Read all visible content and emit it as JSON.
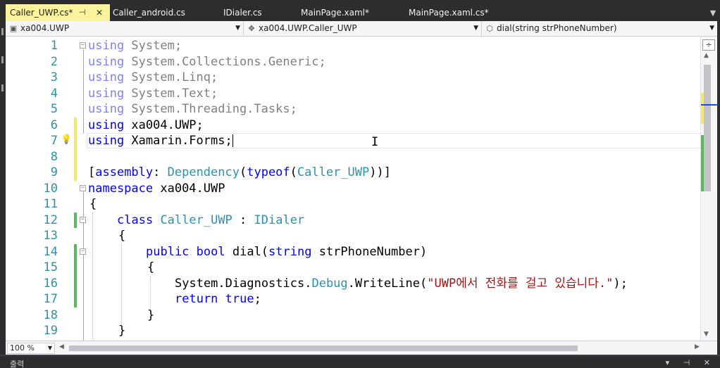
{
  "tabs": [
    {
      "label": "Caller_UWP.cs*",
      "active": true,
      "pin": "⊣",
      "close": "✕"
    },
    {
      "label": "Caller_android.cs",
      "active": false
    },
    {
      "label": "IDialer.cs",
      "active": false
    },
    {
      "label": "MainPage.xaml*",
      "active": false
    },
    {
      "label": "MainPage.xaml.cs*",
      "active": false
    }
  ],
  "tab_dropdown": "▼",
  "nav": {
    "project": "xa004.UWP",
    "type": "xa004.UWP.Caller_UWP",
    "member": "dial(string strPhoneNumber)",
    "project_icon": "csharp-project-icon",
    "type_icon": "class-icon",
    "member_icon": "method-icon"
  },
  "editor": {
    "line_numbers": [
      "1",
      "2",
      "3",
      "4",
      "5",
      "6",
      "7",
      "8",
      "9",
      "10",
      "11",
      "12",
      "13",
      "14",
      "15",
      "16",
      "17",
      "18",
      "19"
    ],
    "lines": {
      "l1a": "using",
      "l1b": " System;",
      "l2a": "using",
      "l2b": " System.Collections.Generic;",
      "l3a": "using",
      "l3b": " System.Linq;",
      "l4a": "using",
      "l4b": " System.Text;",
      "l5a": "using",
      "l5b": " System.Threading.Tasks;",
      "l6a": "using",
      "l6b": " xa004.UWP;",
      "l7a": "using",
      "l7b": " Xamarin.Forms;",
      "l9a": "[",
      "l9b": "assembly",
      "l9c": ": ",
      "l9d": "Dependency",
      "l9e": "(",
      "l9f": "typeof",
      "l9g": "(",
      "l9h": "Caller_UWP",
      "l9i": "))]",
      "l10a": "namespace",
      "l10b": " xa004.UWP",
      "l11": "{",
      "l12a": "class",
      "l12b": " ",
      "l12c": "Caller_UWP",
      "l12d": " : ",
      "l12e": "IDialer",
      "l13": "{",
      "l14a": "public",
      "l14b": " ",
      "l14c": "bool",
      "l14d": " dial(",
      "l14e": "string",
      "l14f": " strPhoneNumber)",
      "l15": "{",
      "l16a": "System.Diagnostics.",
      "l16b": "Debug",
      "l16c": ".WriteLine(",
      "l16d": "\"UWP에서 전화를 걸고 있습니다.\"",
      "l16e": ");",
      "l17a": "return",
      "l17b": " ",
      "l17c": "true",
      "l17d": ";",
      "l18": "}",
      "l19": "}"
    },
    "cursor_glyph": "I",
    "lightbulb_icon": "lightbulb-icon"
  },
  "scrollbar": {
    "split_button": "÷",
    "up": "▲",
    "down": "▼"
  },
  "bottom": {
    "zoom": "100 %",
    "zoom_arrow": "▼",
    "left": "◀",
    "right": "▶"
  },
  "output_panel": {
    "title": "출력",
    "buttons": "▾ ⊣ ✕"
  },
  "colors": {
    "keyword": "#0000ff",
    "type": "#2b91af",
    "string": "#a31515",
    "line_number": "#2b91af",
    "active_tab": "#fbf29c",
    "change_saved": "#5cb85c",
    "change_unsaved": "#f5e66c"
  }
}
